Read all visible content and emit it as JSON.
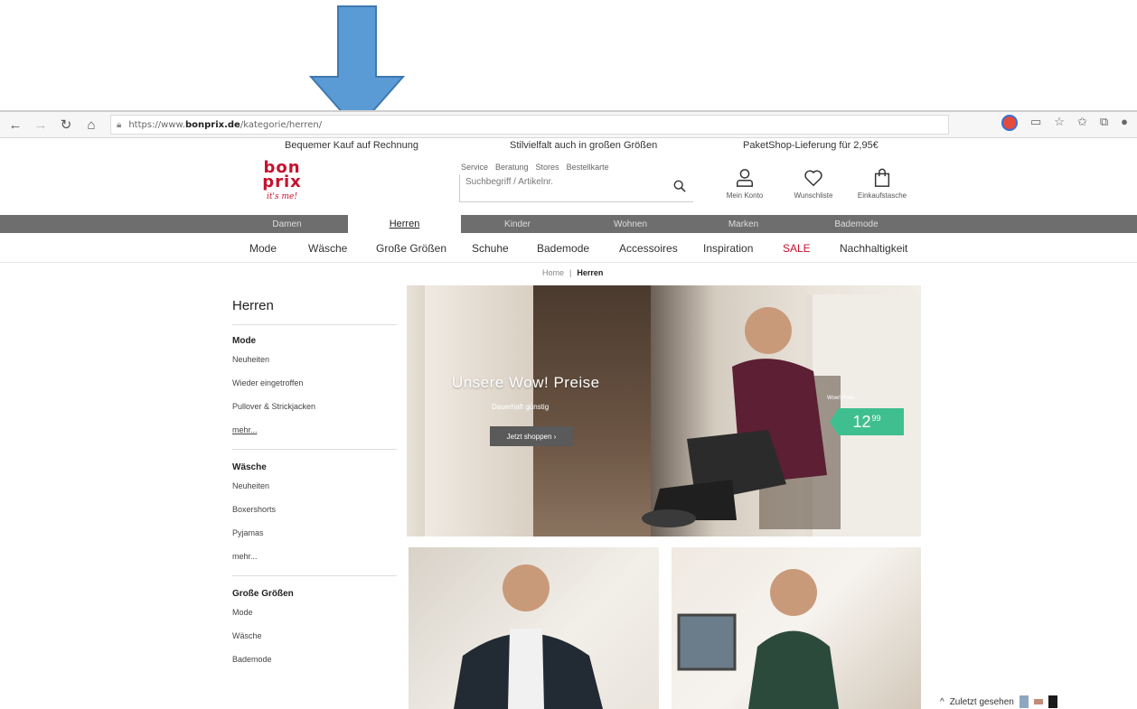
{
  "browser": {
    "url_prefix": "https://www.",
    "url_domain": "bonprix.de",
    "url_path": "/kategorie/herren/"
  },
  "promo": [
    "Bequemer Kauf auf Rechnung",
    "Stilvielfalt auch in großen Größen",
    "PaketShop-Lieferung für 2,95€"
  ],
  "header": {
    "logo_line1": "bon",
    "logo_line2": "prix",
    "logo_line3": "it's me!",
    "service_links": [
      "Service",
      "Beratung",
      "Stores",
      "Bestellkarte"
    ],
    "search_placeholder": "Suchbegriff / Artikelnr.",
    "account_label": "Mein Konto",
    "wishlist_label": "Wunschliste",
    "bag_label": "Einkaufstasche"
  },
  "categories": [
    "Damen",
    "Herren",
    "Kinder",
    "Wohnen",
    "Marken",
    "Bademode"
  ],
  "sub_nav": [
    "Mode",
    "Wäsche",
    "Große Größen",
    "Schuhe",
    "Bademode",
    "Accessoires",
    "Inspiration",
    "SALE",
    "Nachhaltigkeit"
  ],
  "breadcrumb": {
    "home": "Home",
    "sep": "|",
    "current": "Herren"
  },
  "sidebar": {
    "title": "Herren",
    "sections": [
      {
        "heading": "Mode",
        "links": [
          "Neuheiten",
          "Wieder eingetroffen",
          "Pullover & Strickjacken"
        ],
        "more": "mehr..."
      },
      {
        "heading": "Wäsche",
        "links": [
          "Neuheiten",
          "Boxershorts",
          "Pyjamas"
        ],
        "more": "mehr..."
      },
      {
        "heading": "Große Größen",
        "links": [
          "Mode",
          "Wäsche",
          "Bademode"
        ]
      }
    ]
  },
  "hero": {
    "title": "Unsere Wow! Preise",
    "subtitle": "Dauerhaft günstig",
    "button": "Jetzt shoppen ›",
    "price_label": "Wow! Preis",
    "price_main": "12",
    "price_cents": "99"
  },
  "recent": {
    "label": "Zuletzt gesehen"
  },
  "colors": {
    "brand": "#c8102e",
    "nav_bg": "#6e6e6e",
    "price_tag": "#3fbf8f",
    "arrow": "#5b9bd5"
  }
}
